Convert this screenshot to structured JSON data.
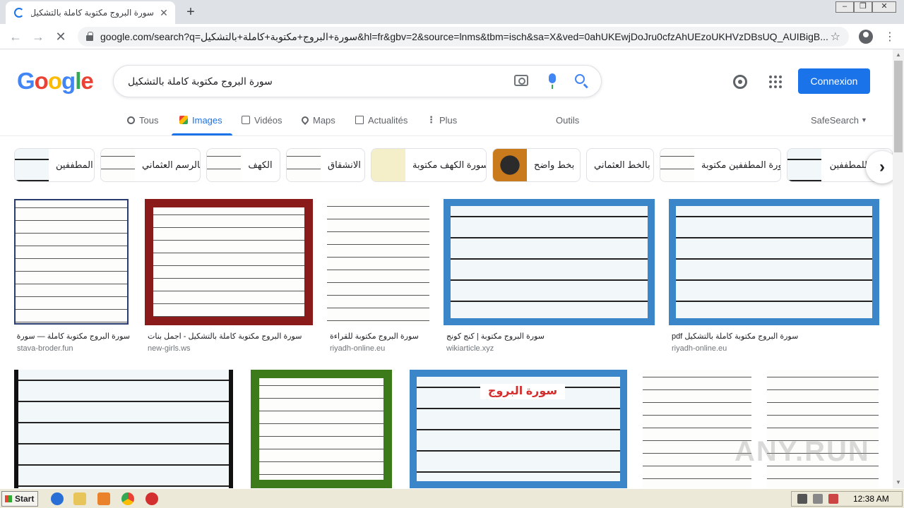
{
  "browser": {
    "tab_title": "سورة البروج مكتوبة كاملة بالتشكيل - ",
    "url": "google.com/search?q=سورة+البروج+مكتوبة+كاملة+بالتشكيل&hl=fr&gbv=2&source=lnms&tbm=isch&sa=X&ved=0ahUKEwjDoJru0cfzAhUEzoUKHVzDBsUQ_AUIBigB..."
  },
  "google": {
    "logo": "Google",
    "query": "سورة البروج مكتوبة كاملة بالتشكيل",
    "signin_label": "Connexion",
    "tabs": [
      {
        "label": "Tous"
      },
      {
        "label": "Images"
      },
      {
        "label": "Vidéos"
      },
      {
        "label": "Maps"
      },
      {
        "label": "Actualités"
      },
      {
        "label": "Plus"
      }
    ],
    "tools_label": "Outils",
    "safesearch_label": "SafeSearch"
  },
  "chips": [
    {
      "label": "المطففين"
    },
    {
      "label": "بالرسم العثماني"
    },
    {
      "label": "الكهف"
    },
    {
      "label": "الانشقاق"
    },
    {
      "label": "سورة الكهف مكتوبة"
    },
    {
      "label": "بخط واضح"
    },
    {
      "label": "بالخط العثماني"
    },
    {
      "label": "سورة المطففين مكتوبة"
    },
    {
      "label": "ويل للمطففين"
    }
  ],
  "results_row1": [
    {
      "caption": "سورة البروج مكتوبة كاملة — سورة ال...",
      "source": "stava-broder.fun"
    },
    {
      "caption": "سورة البروج مكتوبة كاملة بالتشكيل - اجمل بنات",
      "source": "new-girls.ws"
    },
    {
      "caption": "سورة البروج مكتوبة للقراءة",
      "source": "riyadh-online.eu"
    },
    {
      "caption": "سورة البروج مكتوبة | كنج كونج",
      "source": "wikiarticle.xyz"
    },
    {
      "caption": "سورة البروج مكتوبة كاملة بالتشكيل pdf",
      "source": "riyadh-online.eu"
    }
  ],
  "image_text": {
    "buruj_banner": "سورة البروج",
    "watermark": "ANY.RUN"
  },
  "taskbar": {
    "start_label": "Start",
    "clock": "12:38 AM"
  }
}
